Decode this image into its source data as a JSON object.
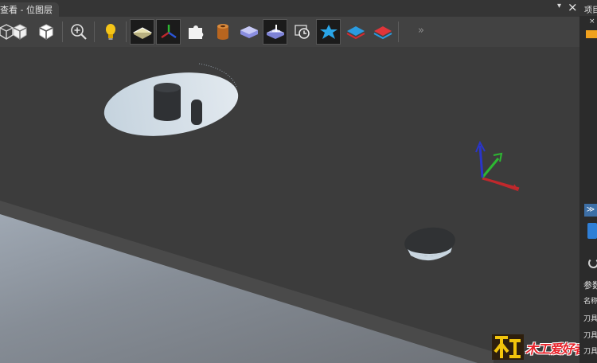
{
  "tab": {
    "title": "查看 - 位图层",
    "pin": "▾",
    "close": "×"
  },
  "toolbar": {
    "items": [
      {
        "name": "view-box-wire-icon"
      },
      {
        "name": "view-box-solid-icon"
      },
      {
        "name": "zoom-fit-icon"
      },
      {
        "name": "light-bulb-icon"
      },
      {
        "name": "plane-sheet-icon"
      },
      {
        "name": "axis-triad-icon"
      },
      {
        "name": "puzzle-part-icon"
      },
      {
        "name": "cylinder-stock-icon"
      },
      {
        "name": "block-stock-icon"
      },
      {
        "name": "toolpath-block-icon"
      },
      {
        "name": "clock-simulate-icon"
      },
      {
        "name": "star-feature-icon"
      },
      {
        "name": "layer-blue-icon"
      },
      {
        "name": "layer-red-icon"
      }
    ],
    "overflow": "»"
  },
  "right_panel": {
    "header": "项目",
    "pin": "▾",
    "close": "×",
    "section_title": "参数",
    "labels": [
      "名称",
      "刀具",
      "刀具",
      "刀具"
    ]
  },
  "watermark": {
    "text": "木工爱好者"
  },
  "colors": {
    "background": "#3c3c3c",
    "toolbar": "#424242",
    "panel": "#2b2b2b",
    "axis_x": "#c0282c",
    "axis_y": "#2db832",
    "axis_z": "#2a35c9",
    "watermark_text": "#e8242c"
  }
}
